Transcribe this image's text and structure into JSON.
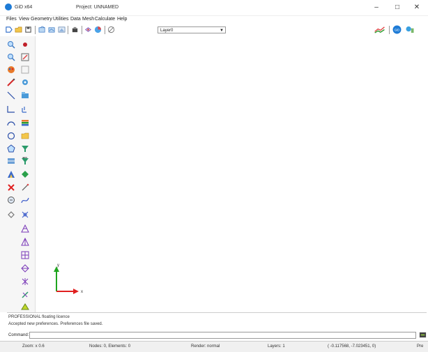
{
  "window": {
    "app_title": "GiD x64",
    "project_title": "Project: UNNAMED",
    "min_glyph": "–",
    "max_glyph": "□",
    "close_glyph": "✕"
  },
  "menu": [
    "Files",
    "View",
    "Geometry",
    "Utilities",
    "Data",
    "Mesh",
    "Calculate",
    "Help"
  ],
  "toolbar": {
    "layer_value": "Layer0",
    "layer_arrow": "▼",
    "left_icons": [
      "new-icon",
      "open-icon",
      "save-icon",
      "zoom-window-icon",
      "zoom-frame-icon",
      "render-icon",
      "cut-icon",
      "layer-icon",
      "color-icon",
      "view-icon"
    ],
    "right_icons": [
      "postprocess-icon",
      "gid-logo-icon",
      "help-icon"
    ]
  },
  "sidebar_icons": [
    "zoom-in-icon",
    "point-icon",
    "zoom-out-icon",
    "edit-icon",
    "color-palette-icon",
    "surface-icon",
    "pencil-line-icon",
    "rotate-icon",
    "line-icon",
    "nurbs-icon",
    "polyline-icon",
    "volume-icon",
    "arc-icon",
    "layers-icon",
    "circle-icon",
    "folder-icon",
    "polygon-icon",
    "filter-icon",
    "surface-nurbs-icon",
    "funnel-icon",
    "assign-icon",
    "diamond-icon",
    "delete-icon",
    "wand-icon",
    "copy-icon",
    "curve-icon",
    "move-icon",
    "extrude-icon",
    "mesh-icon",
    "mesh-structured-icon",
    "mesh-quad-icon",
    "mesh-edit-icon",
    "mesh-refine-icon",
    "mesh-tool-icon",
    "mesh-smooth-icon",
    "mesh-view-icon"
  ],
  "axis": {
    "x_label": "x",
    "y_label": "y"
  },
  "log": [
    "PROFESSIONAL floating licence",
    "Accepted new preferences. Preferences file saved."
  ],
  "command": {
    "label": "Command:",
    "value": ""
  },
  "status": {
    "zoom": "Zoom: x 0.6",
    "nodes": "Nodes: 0, Elements: 0",
    "render": "Render: normal",
    "layers": "Layers: 1",
    "coords": "( -0.117568, -7.023451, 0)",
    "pre": "Pre"
  },
  "colors": {
    "accent": "#1e7bd6",
    "axis_x": "#e02020",
    "axis_y": "#1fa51f"
  }
}
